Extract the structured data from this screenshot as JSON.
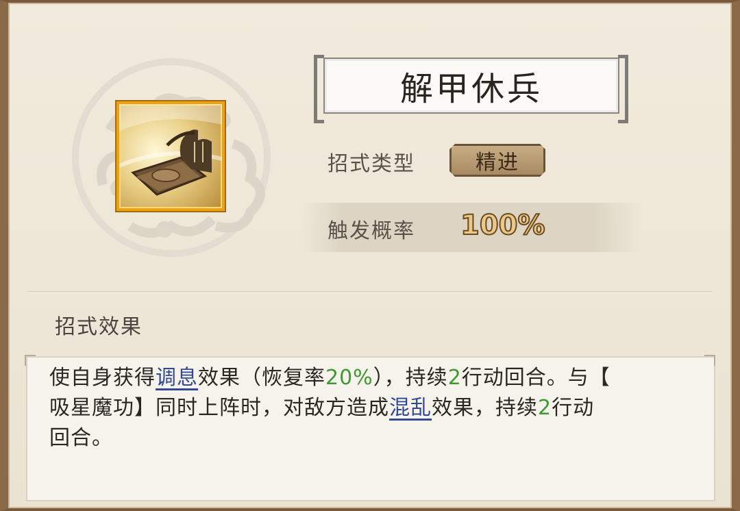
{
  "skill": {
    "name": "解甲休兵",
    "type_label": "招式类型",
    "type_value": "精进",
    "rate_label": "触发概率",
    "rate_value": "100%",
    "icon": "scroll-and-hat-icon"
  },
  "effect": {
    "heading": "招式效果",
    "line1_a": "使自身获得",
    "line1_kw": "调息",
    "line1_b": "效果（恢复率",
    "line1_num": "20%",
    "line1_c": "），持续",
    "line1_turns": "2",
    "line1_d": "行动回合。与【",
    "line2_a": "吸星魔功】同时上阵时，对敌方造成",
    "line2_kw": "混乱",
    "line2_b": "效果，持续",
    "line2_turns": "2",
    "line2_c": "行动",
    "line3": "回合。"
  },
  "colors": {
    "keyword_blue": "#2f4a92",
    "number_green": "#3e9a2e",
    "icon_border": "#e7a21c"
  }
}
